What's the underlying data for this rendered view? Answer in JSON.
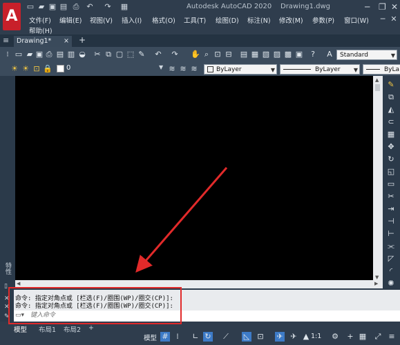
{
  "window": {
    "app_title": "Autodesk AutoCAD 2020",
    "file_title": "Drawing1.dwg",
    "app_logo_letter": "A"
  },
  "menu": {
    "items": [
      "文件(F)",
      "编辑(E)",
      "视图(V)",
      "插入(I)",
      "格式(O)",
      "工具(T)",
      "绘图(D)",
      "标注(N)",
      "修改(M)",
      "参数(P)",
      "窗口(W)"
    ],
    "help": "帮助(H)"
  },
  "tabs": {
    "active": "Drawing1*",
    "close_glyph": "×",
    "add_glyph": "+"
  },
  "toolbar1": {
    "text_style": "Standard"
  },
  "toolbar2": {
    "layer": "0",
    "color": "ByLayer",
    "linetype": "ByLayer",
    "lineweight": "ByLa"
  },
  "left_panel": {
    "vertical_label": "特性"
  },
  "command": {
    "history": [
      "命令: 指定对角点或 [栏选(F)/圈围(WP)/圈交(CP)]:",
      "命令: 指定对角点或 [栏选(F)/圈围(WP)/圈交(CP)]:"
    ],
    "input_placeholder": "键入命令"
  },
  "status": {
    "model_tab": "模型",
    "layout_tabs": [
      "布局1",
      "布局2"
    ],
    "add_glyph": "+",
    "model_button": "模型",
    "scale": "1:1"
  },
  "colors": {
    "accent_red": "#e12a2a",
    "canvas": "#000000",
    "chrome": "#2f3d4d"
  }
}
